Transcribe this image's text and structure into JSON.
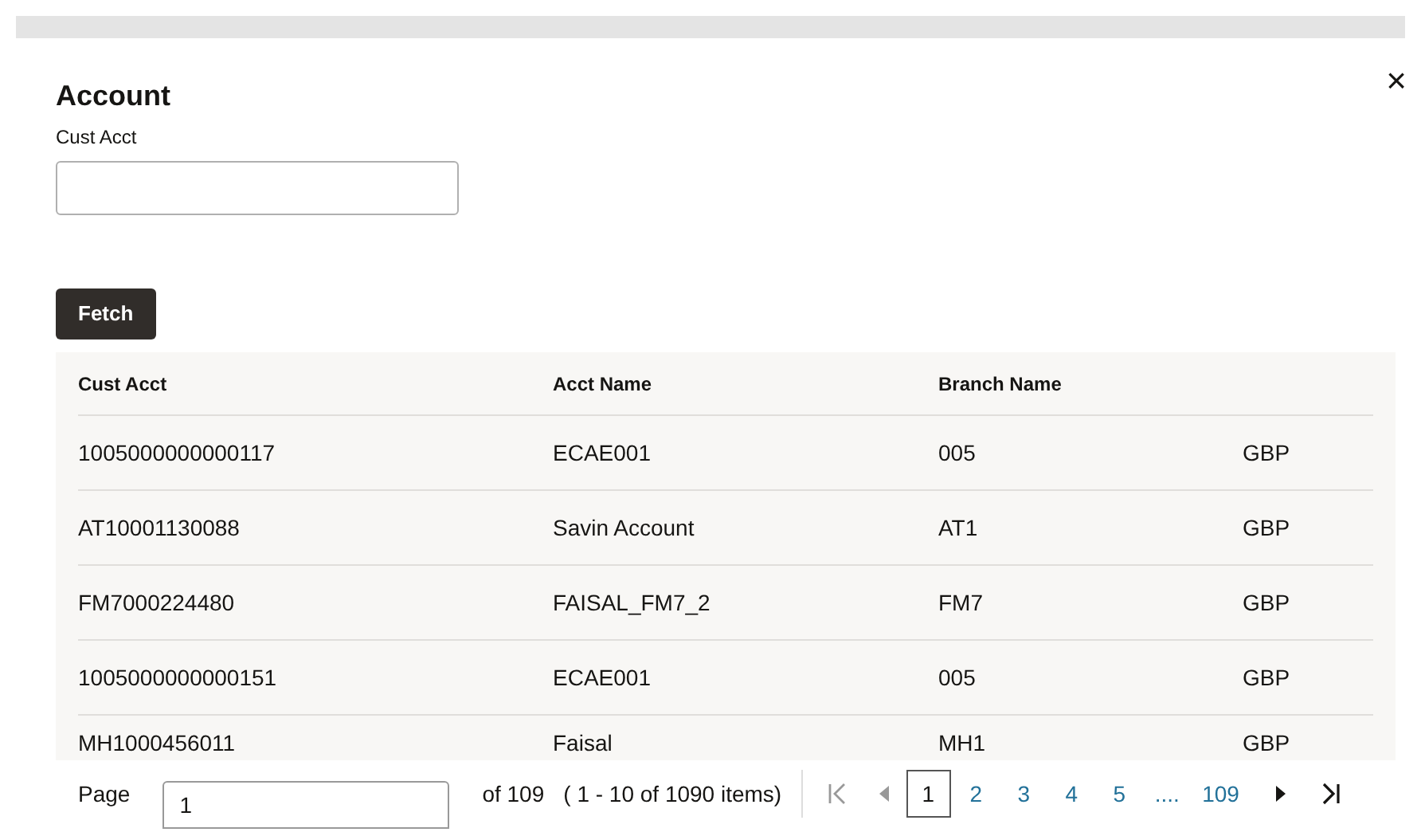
{
  "dialog": {
    "title": "Account",
    "close": "×"
  },
  "filter": {
    "label": "Cust Acct"
  },
  "fetch_button": "Fetch",
  "table": {
    "columns": [
      "Cust Acct",
      "Acct Name",
      "Branch Name",
      ""
    ],
    "rows": [
      [
        "1005000000000117",
        "ECAE001",
        "005",
        "GBP"
      ],
      [
        "AT10001130088",
        "Savin Account",
        "AT1",
        "GBP"
      ],
      [
        "FM7000224480",
        "FAISAL_FM7_2",
        "FM7",
        "GBP"
      ],
      [
        "1005000000000151",
        "ECAE001",
        "005",
        "GBP"
      ],
      [
        "MH1000456011",
        "Faisal",
        "MH1",
        "GBP"
      ]
    ]
  },
  "pagination": {
    "label": "Page",
    "page_value": "1",
    "of_pages": "of 109",
    "items_info": "( 1 - 10 of 1090 items)",
    "pages": [
      {
        "label": "1",
        "selected": true
      },
      {
        "label": "2",
        "selected": false
      },
      {
        "label": "3",
        "selected": false
      },
      {
        "label": "4",
        "selected": false
      },
      {
        "label": "5",
        "selected": false
      },
      {
        "label": "....",
        "selected": false
      },
      {
        "label": "109",
        "selected": false
      }
    ]
  }
}
